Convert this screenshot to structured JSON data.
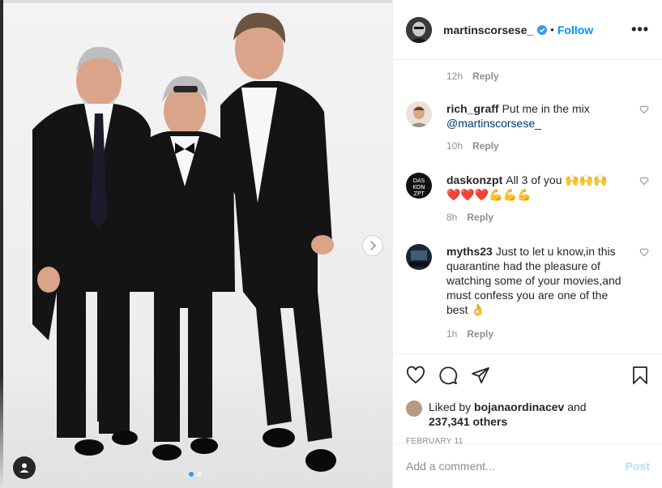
{
  "post": {
    "username": "martinscorsese_",
    "separator": "•",
    "follow_label": "Follow",
    "more_label": "•••"
  },
  "first_comment_meta": {
    "time": "12h",
    "reply_label": "Reply"
  },
  "comments": [
    {
      "user": "rich_graff",
      "text": "Put me in the mix",
      "mention": "@martinscorsese_",
      "time": "10h",
      "reply_label": "Reply"
    },
    {
      "user": "daskonzpt",
      "text": "All 3 of you 🙌🙌🙌",
      "text_line2": "❤️❤️❤️💪💪💪",
      "time": "8h",
      "reply_label": "Reply"
    },
    {
      "user": "myths23",
      "text": "Just to let u know,in this quarantine had the pleasure of watching some of your movies,and must confess you are one of the best 👌",
      "time": "1h",
      "reply_label": "Reply"
    }
  ],
  "likes": {
    "prefix": "Liked by",
    "user": "bojanaordinacev",
    "and": "and",
    "count": "237,341 others"
  },
  "date": "FEBRUARY 11",
  "add_comment": {
    "placeholder": "Add a comment...",
    "post_label": "Post"
  },
  "colors": {
    "link": "#0095f6",
    "post_disabled": "#b2dffc",
    "verified": "#3897f0"
  },
  "icons": [
    "heart-icon",
    "comment-icon",
    "share-icon",
    "bookmark-icon",
    "verified-icon",
    "chevron-right-icon",
    "user-tag-icon"
  ],
  "carousel": {
    "slides": 2,
    "active": 1
  }
}
